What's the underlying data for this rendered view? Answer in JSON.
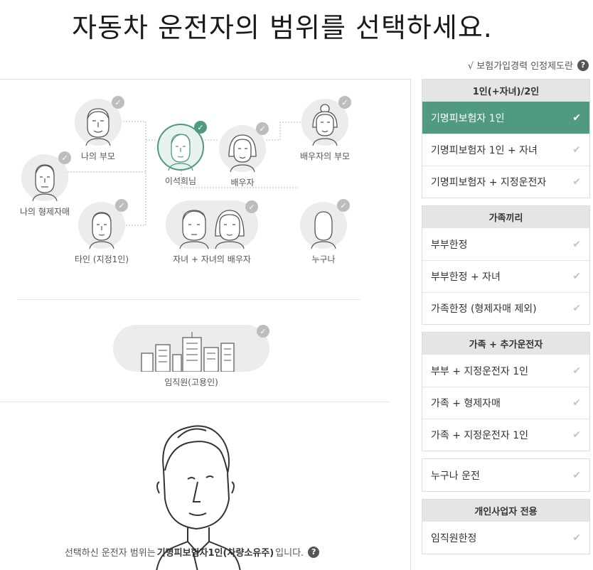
{
  "title": "자동차 운전자의 범위를 선택하세요.",
  "info_link": {
    "label": "√ 보험가입경력 인정제도란",
    "icon": "?"
  },
  "tree": {
    "my_parents": "나의 부모",
    "my_siblings": "나의 형제자매",
    "other": "타인 (지정1인)",
    "self": "이석희님",
    "spouse": "배우자",
    "spouse_parents": "배우자의 부모",
    "children": "자녀 + 자녀의 배우자",
    "anyone": "누구나",
    "employees": "임직원(고용인)",
    "check_symbol": "✓"
  },
  "summary": {
    "prefix": "선택하신 운전자 범위는",
    "selected": "기명피보험자1인(차량소유주)",
    "suffix": "입니다.",
    "help": "?"
  },
  "groups": [
    {
      "header": "1인(+자녀)/2인",
      "options": [
        {
          "label": "기명피보험자 1인",
          "active": true
        },
        {
          "label": "기명피보험자 1인 + 자녀"
        },
        {
          "label": "기명피보험자 + 지정운전자"
        }
      ]
    },
    {
      "header": "가족끼리",
      "options": [
        {
          "label": "부부한정"
        },
        {
          "label": "부부한정 + 자녀"
        },
        {
          "label": "가족한정 (형제자매 제외)"
        }
      ]
    },
    {
      "header": "가족 + 추가운전자",
      "options": [
        {
          "label": "부부 + 지정운전자 1인"
        },
        {
          "label": "가족 + 형제자매"
        },
        {
          "label": "가족 + 지정운전자 1인"
        }
      ]
    },
    {
      "header": "",
      "options": [
        {
          "label": "누구나 운전"
        }
      ]
    },
    {
      "header": "개인사업자 전용",
      "options": [
        {
          "label": "임직원한정"
        }
      ]
    }
  ],
  "tick_symbol": "✔",
  "colors": {
    "accent": "#4f9a80",
    "header_bg": "#e5e5e5",
    "check_off": "#bdbdbd"
  }
}
